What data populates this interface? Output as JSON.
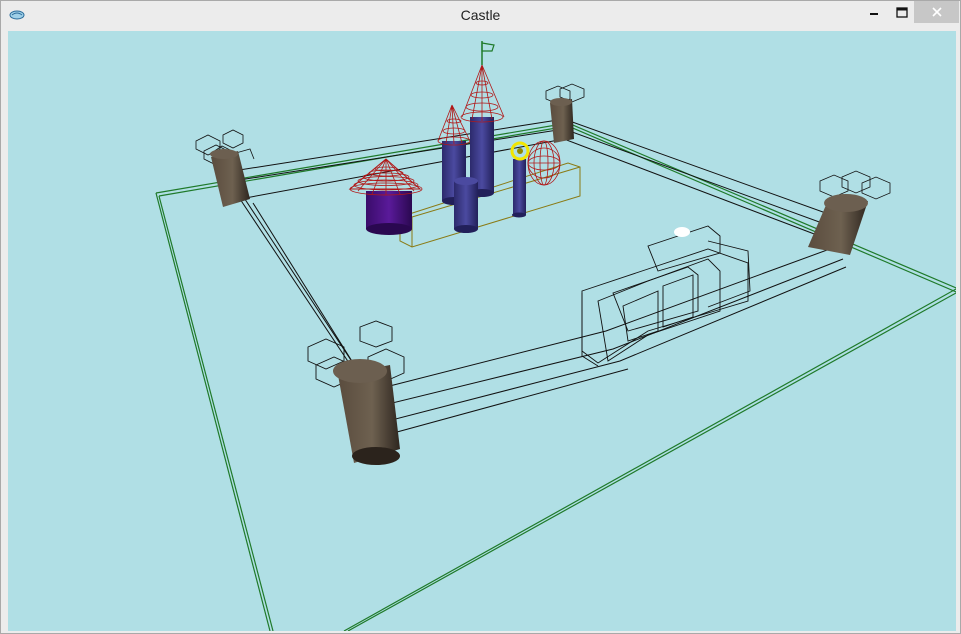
{
  "window": {
    "title": "Castle"
  },
  "controls": {
    "minimize_icon": "minimize-icon",
    "maximize_icon": "maximize-icon",
    "close_icon": "close-icon"
  },
  "scene": {
    "background_color": "#b0dfe5",
    "wall_color": "#1a1a1a",
    "ground_outline_color": "#1f7a2a",
    "tower_color": "#4f4236",
    "keep_color": "#3c3a86",
    "roof_color": "#b01818",
    "ball_color": "#f2e600",
    "flag_color": "#1f7a2a"
  }
}
